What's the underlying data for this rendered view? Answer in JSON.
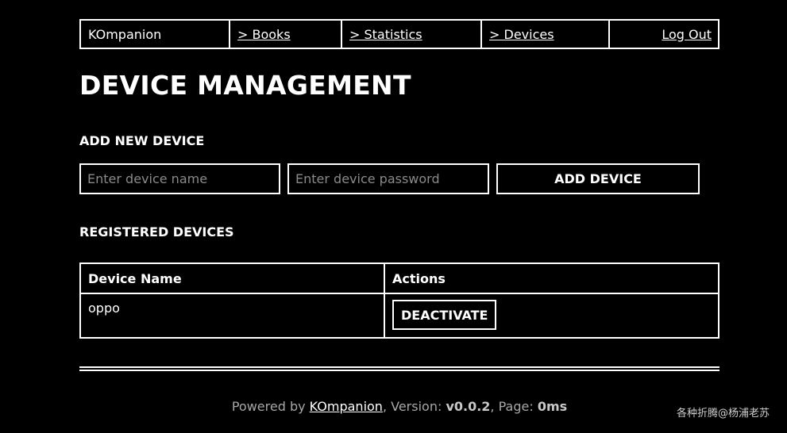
{
  "nav": {
    "brand": "KOmpanion",
    "books": "> Books",
    "statistics": "> Statistics",
    "devices": "> Devices",
    "logout": "Log Out"
  },
  "page_title": "DEVICE MANAGEMENT",
  "add_section": {
    "heading": "ADD NEW DEVICE",
    "name_placeholder": "Enter device name",
    "password_placeholder": "Enter device password",
    "add_button": "ADD DEVICE"
  },
  "registered": {
    "heading": "REGISTERED DEVICES",
    "columns": [
      "Device Name",
      "Actions"
    ],
    "rows": [
      {
        "name": "oppo",
        "action": "DEACTIVATE"
      }
    ]
  },
  "footer": {
    "powered_by": "Powered by ",
    "link": "KOmpanion",
    "version_label": ", Version: ",
    "version": "v0.0.2",
    "page_label": ", Page: ",
    "page_time": "0ms"
  },
  "watermark": "各种折腾@杨浦老苏"
}
